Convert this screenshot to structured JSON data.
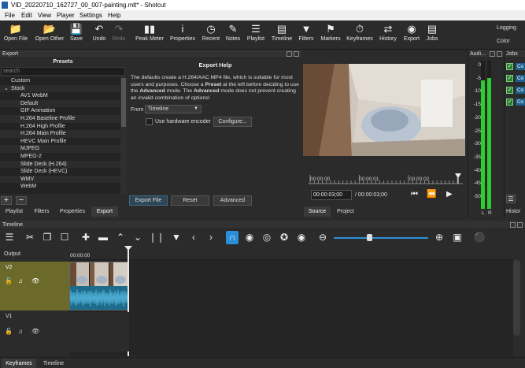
{
  "window": {
    "title": "VID_20220710_162727_00_007-painting.mlt* - Shotcut"
  },
  "menu": [
    "File",
    "Edit",
    "View",
    "Player",
    "Settings",
    "Help"
  ],
  "toolbar": {
    "open_file": "Open File",
    "open_other": "Open Other",
    "save": "Save",
    "undo": "Undo",
    "redo": "Redo",
    "peak_meter": "Peak Meter",
    "properties": "Properties",
    "recent": "Recent",
    "notes": "Notes",
    "playlist": "Playlist",
    "timeline": "Timeline",
    "filters": "Filters",
    "markers": "Markers",
    "keyframes": "Keyframes",
    "history": "History",
    "export": "Export",
    "jobs": "Jobs",
    "logging": "Logging",
    "color": "Color"
  },
  "export_panel": {
    "title": "Export",
    "presets_title": "Presets",
    "search_placeholder": "search",
    "presets": [
      {
        "label": "Custom",
        "level": 0
      },
      {
        "label": "Stock",
        "level": 0,
        "expanded": true
      },
      {
        "label": "AV1 WebM",
        "level": 1
      },
      {
        "label": "Default",
        "level": 1
      },
      {
        "label": "GIF Animation",
        "level": 1
      },
      {
        "label": "H.264 Baseline Profile",
        "level": 1
      },
      {
        "label": "H.264 High Profile",
        "level": 1
      },
      {
        "label": "H.264 Main Profile",
        "level": 1
      },
      {
        "label": "HEVC Main Profile",
        "level": 1
      },
      {
        "label": "MJPEG",
        "level": 1
      },
      {
        "label": "MPEG-2",
        "level": 1
      },
      {
        "label": "Slide Deck (H.264)",
        "level": 1
      },
      {
        "label": "Slide Deck (HEVC)",
        "level": 1
      },
      {
        "label": "WMV",
        "level": 1
      },
      {
        "label": "WebM",
        "level": 1
      }
    ],
    "help_title": "Export Help",
    "help_text_1": "The defaults create a H.264/AAC MP4 file, which is suitable for most users and purposes. Choose a ",
    "help_bold_1": "Preset",
    "help_text_2": " at the left before deciding to use the ",
    "help_bold_2": "Advanced",
    "help_text_3": " mode. The ",
    "help_bold_3": "Advanced",
    "help_text_4": " mode does not prevent creating an invalid combination of options!",
    "from_label": "From",
    "from_value": "Timeline",
    "hw_encoder_label": "Use hardware encoder",
    "hw_encoder_checked": false,
    "configure_label": "Configure...",
    "export_file_label": "Export File",
    "reset_label": "Reset",
    "advanced_label": "Advanced",
    "add_label": "+",
    "remove_label": "−"
  },
  "left_tabs": [
    {
      "label": "Playlist",
      "active": false
    },
    {
      "label": "Filters",
      "active": false
    },
    {
      "label": "Properties",
      "active": false
    },
    {
      "label": "Export",
      "active": true
    }
  ],
  "player": {
    "ruler_labels": [
      "00:00:00",
      "00:00:01",
      "00:00:02"
    ],
    "current_time": "00:00:03;00",
    "duration": "/ 00:00:03;00",
    "tabs": [
      {
        "label": "Source",
        "active": true
      },
      {
        "label": "Project",
        "active": false
      }
    ]
  },
  "audio_meter": {
    "title": "Audi...",
    "db_labels": [
      "0",
      "-5",
      "-10",
      "-15",
      "-20",
      "-25",
      "-30",
      "-35",
      "-40",
      "-45",
      "-50"
    ],
    "channels": [
      "L",
      "R"
    ],
    "level_left_db": -7,
    "level_right_db": -6
  },
  "jobs_panel": {
    "title": "Jobs",
    "job_labels": [
      "Co",
      "Co",
      "Co",
      "Co"
    ],
    "history_tab": "Histor"
  },
  "timeline": {
    "title": "Timeline",
    "output_label": "Output",
    "ruler_time": "00:00:00",
    "tracks": [
      {
        "name": "V2"
      },
      {
        "name": "V1"
      }
    ]
  },
  "bottom_tabs": [
    {
      "label": "Keyframes",
      "active": true
    },
    {
      "label": "Timeline",
      "active": false
    }
  ],
  "colors": {
    "accent": "#2a8fd8",
    "track_selected": "#6b6a2a",
    "meter_green": "#2ecc2e"
  }
}
